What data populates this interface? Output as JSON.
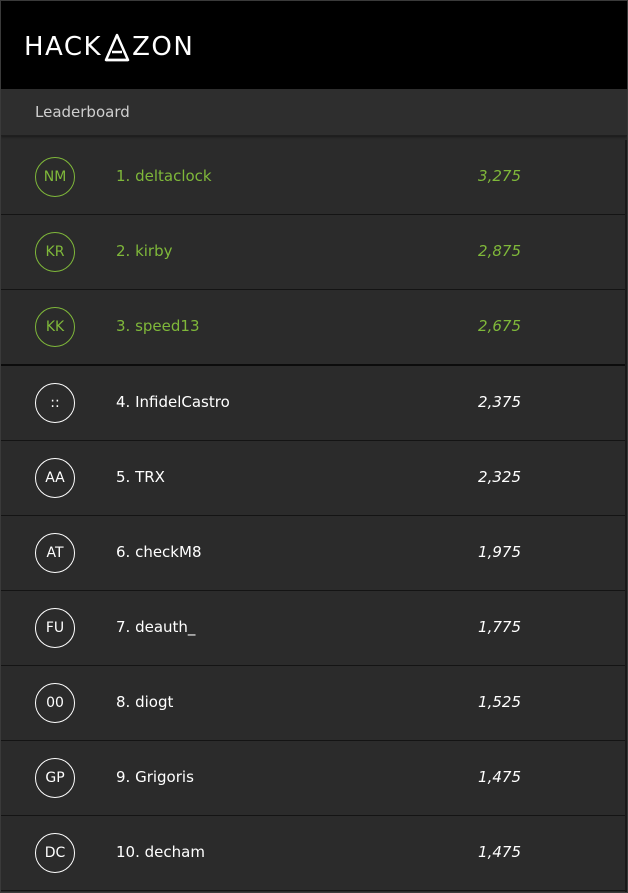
{
  "brand": {
    "logo_left": "HACK",
    "logo_right": "ZON",
    "logo_full": "HACKAZON"
  },
  "section": {
    "title": "Leaderboard"
  },
  "colors": {
    "accent": "#7fb83a",
    "header_bg": "#000000",
    "row_bg": "#2b2b2b",
    "text": "#ffffff"
  },
  "leaderboard": [
    {
      "initials": "NM",
      "label": "1. deltaclock",
      "score": "3,275",
      "top": true
    },
    {
      "initials": "KR",
      "label": "2. kirby",
      "score": "2,875",
      "top": true
    },
    {
      "initials": "KK",
      "label": "3. speed13",
      "score": "2,675",
      "top": true
    },
    {
      "initials": "::",
      "label": "4. InfidelCastro",
      "score": "2,375",
      "top": false
    },
    {
      "initials": "AA",
      "label": "5. TRX",
      "score": "2,325",
      "top": false
    },
    {
      "initials": "AT",
      "label": "6. checkM8",
      "score": "1,975",
      "top": false
    },
    {
      "initials": "FU",
      "label": "7. deauth_",
      "score": "1,775",
      "top": false
    },
    {
      "initials": "00",
      "label": "8. diogt",
      "score": "1,525",
      "top": false
    },
    {
      "initials": "GP",
      "label": "9. Grigoris",
      "score": "1,475",
      "top": false
    },
    {
      "initials": "DC",
      "label": "10. decham",
      "score": "1,475",
      "top": false
    }
  ]
}
